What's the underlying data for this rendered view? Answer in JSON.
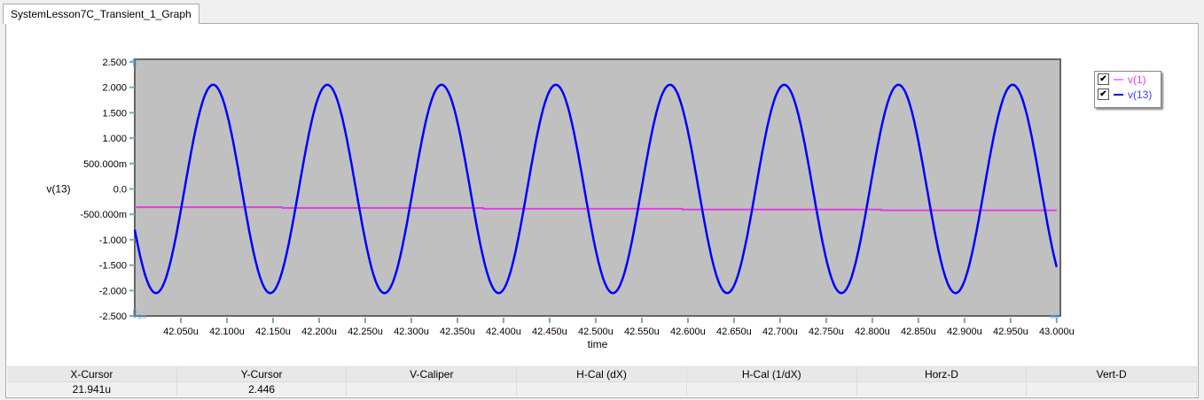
{
  "tab": {
    "label": "SystemLesson7C_Transient_1_Graph"
  },
  "colors": {
    "v1": "#e040e0",
    "v13": "#0000ff",
    "plot_bg": "#c0c0c0"
  },
  "legend": [
    {
      "label": "v(1)",
      "checked": true,
      "color": "#e040e0"
    },
    {
      "label": "v(13)",
      "checked": true,
      "color": "#0000ff"
    }
  ],
  "chart_data": {
    "type": "line",
    "xlabel": "time",
    "ylabel": "v(13)",
    "xlim": [
      42.0,
      43.004
    ],
    "ylim": [
      -2.5,
      2.5
    ],
    "xticks": [
      "42.050u",
      "42.100u",
      "42.150u",
      "42.200u",
      "42.250u",
      "42.300u",
      "42.350u",
      "42.400u",
      "42.450u",
      "42.500u",
      "42.550u",
      "42.600u",
      "42.650u",
      "42.700u",
      "42.750u",
      "42.800u",
      "42.850u",
      "42.900u",
      "42.950u",
      "43.000u"
    ],
    "xtick_values": [
      42.05,
      42.1,
      42.15,
      42.2,
      42.25,
      42.3,
      42.35,
      42.4,
      42.45,
      42.5,
      42.55,
      42.6,
      42.65,
      42.7,
      42.75,
      42.8,
      42.85,
      42.9,
      42.95,
      43.0
    ],
    "yticks": [
      "2.500",
      "2.000",
      "1.500",
      "1.000",
      "500.000m",
      "0.0",
      "-500.000m",
      "-1.000",
      "-1.500",
      "-2.000",
      "-2.500"
    ],
    "ytick_values": [
      2.5,
      2,
      1.5,
      1,
      0.5,
      0,
      -0.5,
      -1,
      -1.5,
      -2,
      -2.5
    ],
    "series": [
      {
        "name": "v(1)",
        "x": [
          42.0,
          42.16,
          42.16,
          42.378,
          42.378,
          42.594,
          42.594,
          42.81,
          42.81,
          43.0
        ],
        "y": [
          -0.36,
          -0.36,
          -0.375,
          -0.375,
          -0.39,
          -0.39,
          -0.405,
          -0.405,
          -0.42,
          -0.42
        ]
      },
      {
        "name": "v(13)",
        "function": "sine",
        "amplitude": 2.05,
        "offset": 0,
        "period_u": 0.1239,
        "peak_at_u": 42.085,
        "x_range": [
          42.0,
          43.0
        ]
      }
    ]
  },
  "cursor_table": {
    "headers": [
      "X-Cursor",
      "Y-Cursor",
      "V-Caliper",
      "H-Cal (dX)",
      "H-Cal (1/dX)",
      "Horz-D",
      "Vert-D"
    ],
    "values": [
      "21.941u",
      "2.446",
      "",
      "",
      "",
      "",
      ""
    ]
  }
}
